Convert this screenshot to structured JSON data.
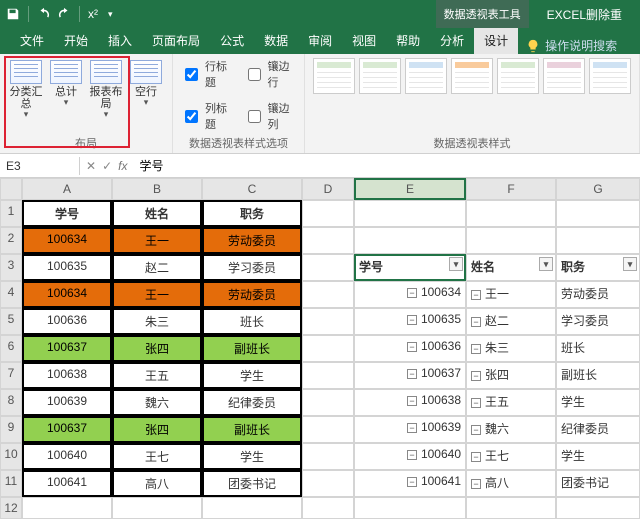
{
  "titlebar": {
    "context_tool": "数据透视表工具",
    "app_title": "EXCEL删除重"
  },
  "tabs": {
    "file": "文件",
    "home": "开始",
    "insert": "插入",
    "pagelayout": "页面布局",
    "formulas": "公式",
    "data": "数据",
    "review": "审阅",
    "view": "视图",
    "help": "帮助",
    "analyze": "分析",
    "design": "设计",
    "tell": "操作说明搜索"
  },
  "ribbon": {
    "subtotals": "分类汇总",
    "grandtotals": "总计",
    "reportlayout": "报表布局",
    "blankrows": "空行",
    "group_layout": "布局",
    "row_headers": "行标题",
    "banded_rows": "镶边行",
    "col_headers": "列标题",
    "banded_cols": "镶边列",
    "group_styleopts": "数据透视表样式选项",
    "group_styles": "数据透视表样式"
  },
  "fbar": {
    "namebox": "E3",
    "value": "学号"
  },
  "cols": {
    "A": "A",
    "B": "B",
    "C": "C",
    "D": "D",
    "E": "E",
    "F": "F",
    "G": "G"
  },
  "rows": [
    "1",
    "2",
    "3",
    "4",
    "5",
    "6",
    "7",
    "8",
    "9",
    "10",
    "11",
    "12"
  ],
  "headers": {
    "id": "学号",
    "name": "姓名",
    "post": "职务"
  },
  "table": [
    {
      "id": "100634",
      "name": "王一",
      "post": "劳动委员",
      "cls": "orange"
    },
    {
      "id": "100635",
      "name": "赵二",
      "post": "学习委员",
      "cls": ""
    },
    {
      "id": "100634",
      "name": "王一",
      "post": "劳动委员",
      "cls": "orange"
    },
    {
      "id": "100636",
      "name": "朱三",
      "post": "班长",
      "cls": ""
    },
    {
      "id": "100637",
      "name": "张四",
      "post": "副班长",
      "cls": "green"
    },
    {
      "id": "100638",
      "name": "王五",
      "post": "学生",
      "cls": ""
    },
    {
      "id": "100639",
      "name": "魏六",
      "post": "纪律委员",
      "cls": ""
    },
    {
      "id": "100637",
      "name": "张四",
      "post": "副班长",
      "cls": "green"
    },
    {
      "id": "100640",
      "name": "王七",
      "post": "学生",
      "cls": ""
    },
    {
      "id": "100641",
      "name": "高八",
      "post": "团委书记",
      "cls": ""
    }
  ],
  "pivot": {
    "hdr_id": "学号",
    "hdr_name": "姓名",
    "hdr_post": "职务",
    "rows": [
      {
        "id": "100634",
        "name": "王一",
        "post": "劳动委员"
      },
      {
        "id": "100635",
        "name": "赵二",
        "post": "学习委员"
      },
      {
        "id": "100636",
        "name": "朱三",
        "post": "班长"
      },
      {
        "id": "100637",
        "name": "张四",
        "post": "副班长"
      },
      {
        "id": "100638",
        "name": "王五",
        "post": "学生"
      },
      {
        "id": "100639",
        "name": "魏六",
        "post": "纪律委员"
      },
      {
        "id": "100640",
        "name": "王七",
        "post": "学生"
      },
      {
        "id": "100641",
        "name": "高八",
        "post": "团委书记"
      }
    ]
  }
}
